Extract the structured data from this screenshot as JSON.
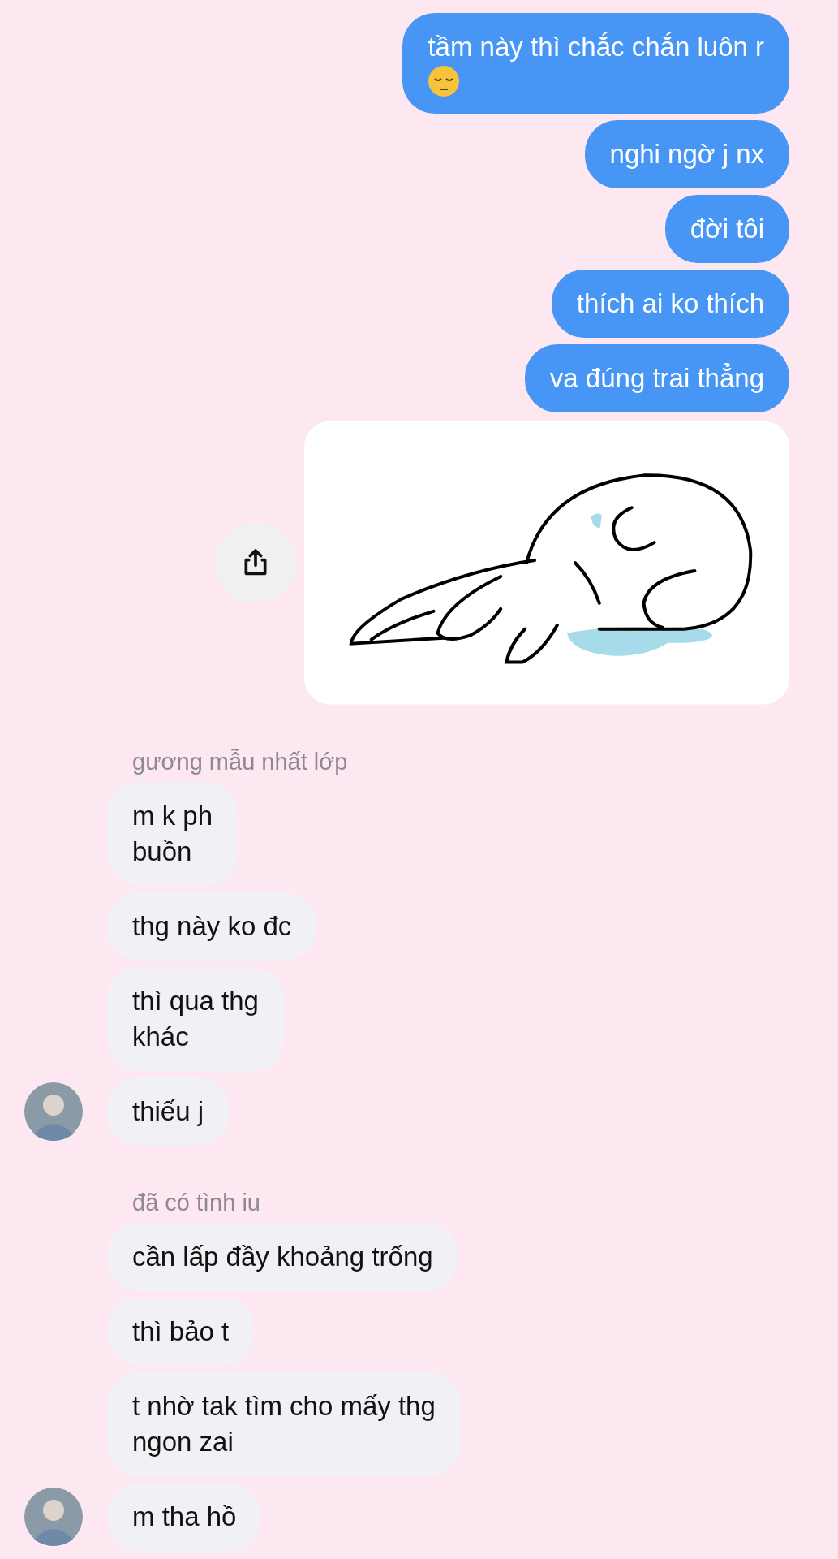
{
  "messages": [
    {
      "kind": "sent_with_emoji",
      "text": "tầm này thì chắc chắn luôn r"
    },
    {
      "kind": "sent",
      "text": "nghi ngờ j nx"
    },
    {
      "kind": "sent",
      "text": "đời tôi"
    },
    {
      "kind": "sent",
      "text": "thích ai ko thích"
    },
    {
      "kind": "sent",
      "text": "va đúng trai thẳng"
    },
    {
      "kind": "sticker"
    },
    {
      "kind": "sender_name",
      "text": "gương mẫu nhất lớp"
    },
    {
      "kind": "received",
      "text": "m k ph\nbuồn",
      "avatar": false
    },
    {
      "kind": "received",
      "text": "thg này ko đc",
      "avatar": false
    },
    {
      "kind": "received",
      "text": "thì qua thg\nkhác",
      "avatar": false
    },
    {
      "kind": "received",
      "text": "thiếu j",
      "avatar": true
    },
    {
      "kind": "sender_name",
      "text": "đã có tình iu"
    },
    {
      "kind": "received",
      "text": "cần lấp đầy khoảng trống",
      "avatar": false
    },
    {
      "kind": "received",
      "text": "thì bảo t",
      "avatar": false
    },
    {
      "kind": "received",
      "text": "t nhờ tak tìm cho mấy thg\nngon zai",
      "avatar": false
    },
    {
      "kind": "received",
      "text": "m tha hồ",
      "avatar": true
    }
  ]
}
